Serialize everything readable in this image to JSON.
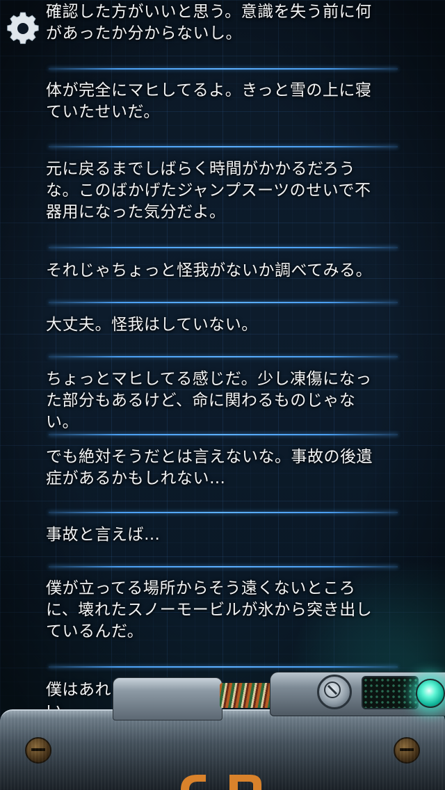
{
  "settings": {
    "icon": "gear-icon"
  },
  "messages": [
    "確認した方がいいと思う。意識を失う前に何",
    "があったか分からないし。",
    "体が完全にマヒしてるよ。きっと雪の上に寝",
    "ていたせいだ。",
    "元に戻るまでしばらく時間がかかるだろう",
    "な。このばかげたジャンプスーツのせいで不",
    "器用になった気分だよ。",
    "それじゃちょっと怪我がないか調べてみる。",
    "大丈夫。怪我はしていない。",
    "ちょっとマヒしてる感じだ。少し凍傷になっ",
    "た部分もあるけど、命に関わるものじゃな",
    "い。",
    "でも絶対そうだとは言えないな。事故の後遺",
    "症があるかもしれない…",
    "事故と言えば…",
    "僕が立ってる場所からそう遠くないところ",
    "に、壊れたスノーモービルが氷から突き出し",
    "ているんだ。",
    "僕はあれ",
    "い"
  ],
  "console": {
    "accent": "#3ff0d0",
    "dial_icon": "dial-icon",
    "status_light": "teal"
  }
}
